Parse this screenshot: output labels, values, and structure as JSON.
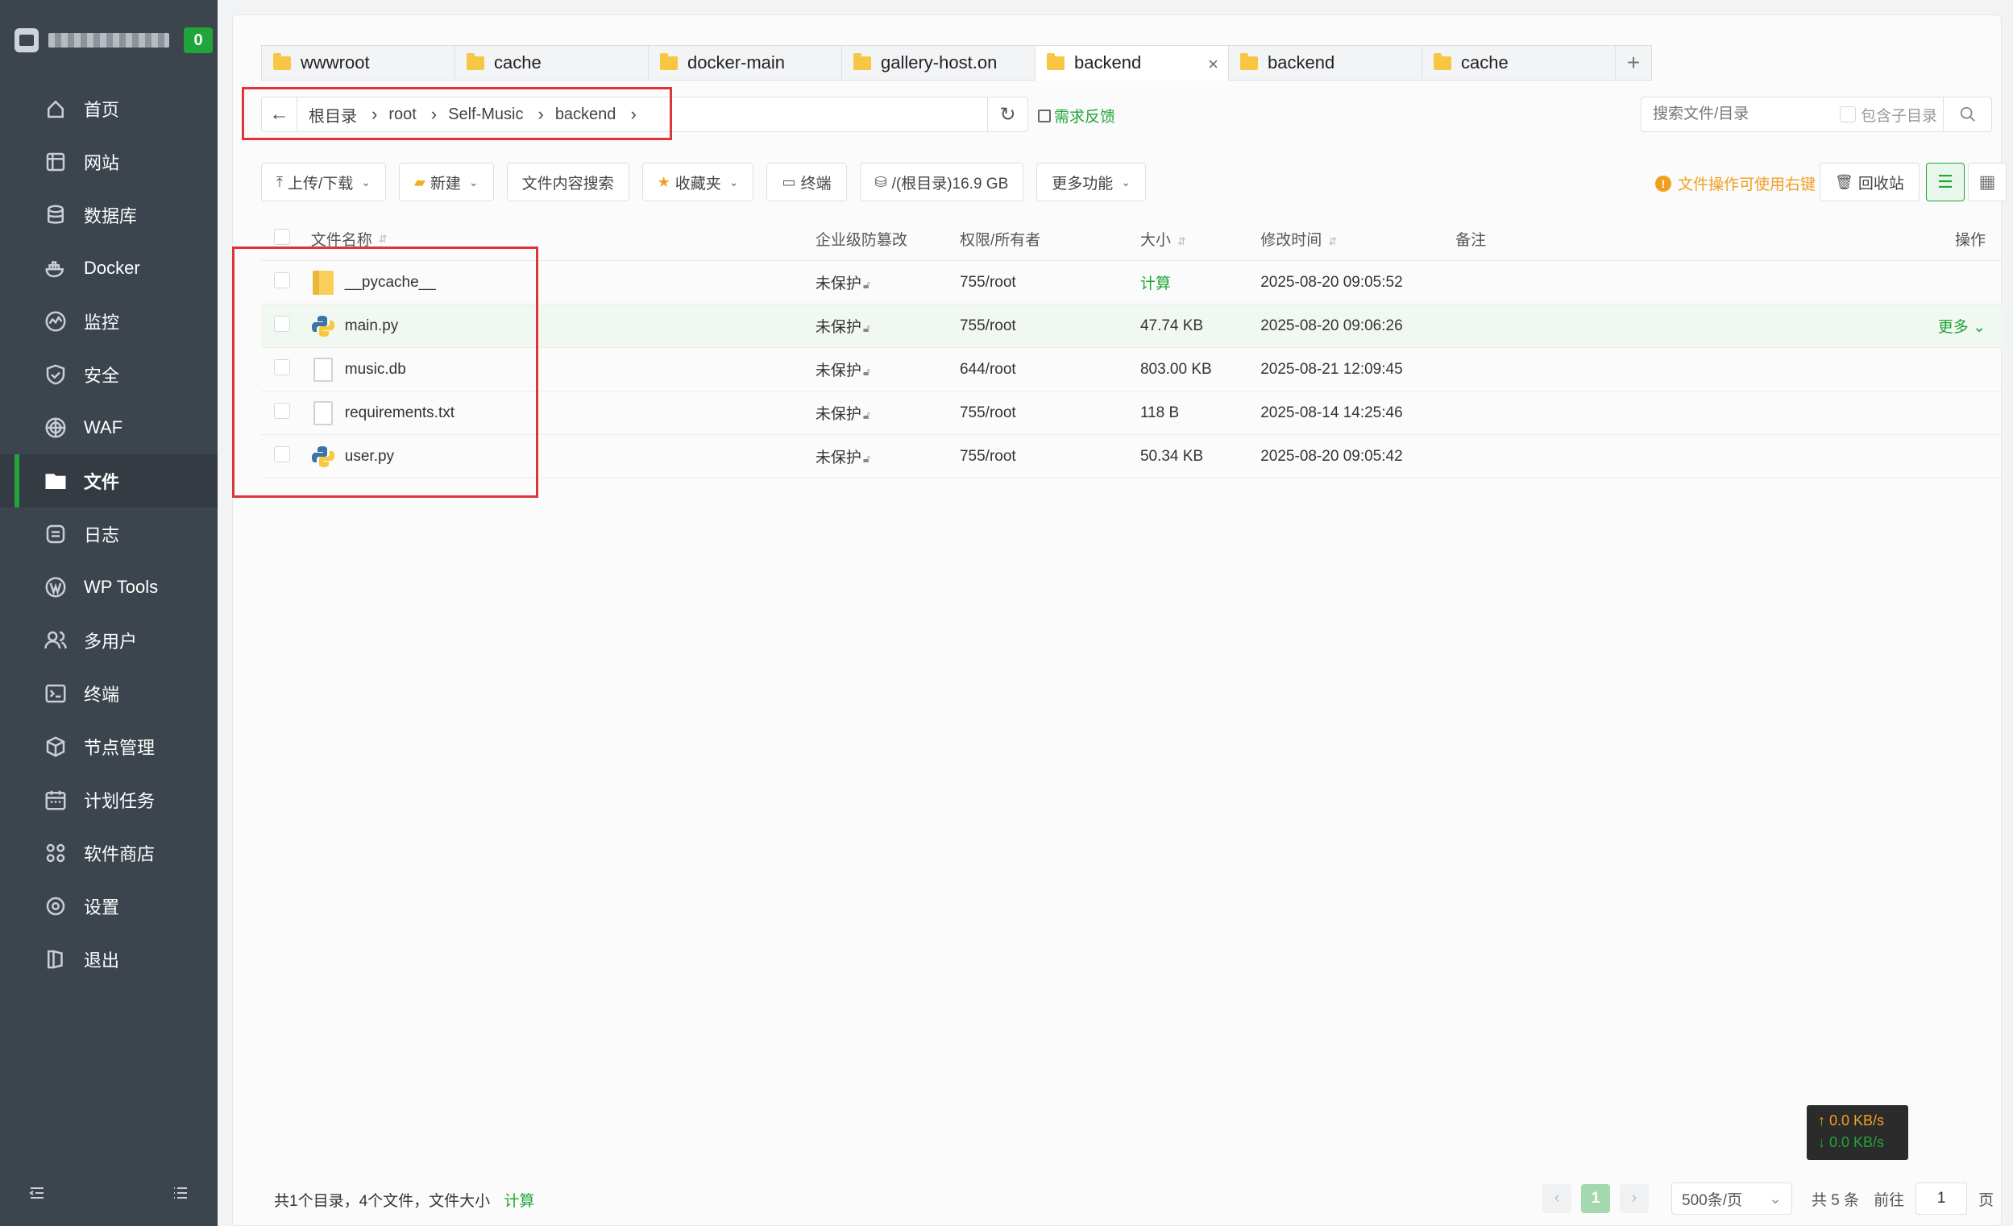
{
  "sidebar": {
    "badge": "0",
    "items": [
      {
        "label": "首页",
        "icon": "home-icon"
      },
      {
        "label": "网站",
        "icon": "globe-icon"
      },
      {
        "label": "数据库",
        "icon": "database-icon"
      },
      {
        "label": "Docker",
        "icon": "docker-icon"
      },
      {
        "label": "监控",
        "icon": "monitor-icon"
      },
      {
        "label": "安全",
        "icon": "shield-icon"
      },
      {
        "label": "WAF",
        "icon": "waf-icon"
      },
      {
        "label": "文件",
        "icon": "folder-icon"
      },
      {
        "label": "日志",
        "icon": "log-icon"
      },
      {
        "label": "WP Tools",
        "icon": "wordpress-icon"
      },
      {
        "label": "多用户",
        "icon": "users-icon"
      },
      {
        "label": "终端",
        "icon": "terminal-icon"
      },
      {
        "label": "节点管理",
        "icon": "cube-icon"
      },
      {
        "label": "计划任务",
        "icon": "calendar-icon"
      },
      {
        "label": "软件商店",
        "icon": "apps-icon"
      },
      {
        "label": "设置",
        "icon": "gear-icon"
      },
      {
        "label": "退出",
        "icon": "logout-icon"
      }
    ],
    "active_index": 7
  },
  "tabs": [
    {
      "label": "wwwroot"
    },
    {
      "label": "cache"
    },
    {
      "label": "docker-main"
    },
    {
      "label": "gallery-host.on"
    },
    {
      "label": "backend",
      "active": true
    },
    {
      "label": "backend"
    },
    {
      "label": "cache"
    }
  ],
  "tab_add": "+",
  "breadcrumb": [
    "根目录",
    "root",
    "Self-Music",
    "backend"
  ],
  "feedback_label": "需求反馈",
  "search": {
    "placeholder": "搜索文件/目录",
    "subdir_label": "包含子目录"
  },
  "toolbar": {
    "upload_download": "上传/下载",
    "new": "新建",
    "content_search": "文件内容搜索",
    "favorites": "收藏夹",
    "terminal": "终端",
    "disk": "/(根目录)16.9 GB",
    "more": "更多功能"
  },
  "tip": "文件操作可使用右键",
  "recycle_label": "回收站",
  "columns": {
    "name": "文件名称",
    "protection": "企业级防篡改",
    "perm": "权限/所有者",
    "size": "大小",
    "time": "修改时间",
    "note": "备注",
    "ops": "操作"
  },
  "files": [
    {
      "name": "__pycache__",
      "type": "folder",
      "protection": "未保护",
      "perm": "755/root",
      "size": "计算",
      "time": "2025-08-20 09:05:52",
      "ops": ""
    },
    {
      "name": "main.py",
      "type": "python",
      "protection": "未保护",
      "perm": "755/root",
      "size": "47.74 KB",
      "time": "2025-08-20 09:06:26",
      "ops": "更多 ⌄"
    },
    {
      "name": "music.db",
      "type": "file",
      "protection": "未保护",
      "perm": "644/root",
      "size": "803.00 KB",
      "time": "2025-08-21 12:09:45",
      "ops": ""
    },
    {
      "name": "requirements.txt",
      "type": "file",
      "protection": "未保护",
      "perm": "755/root",
      "size": "118 B",
      "time": "2025-08-14 14:25:46",
      "ops": ""
    },
    {
      "name": "user.py",
      "type": "python",
      "protection": "未保护",
      "perm": "755/root",
      "size": "50.34 KB",
      "time": "2025-08-20 09:05:42",
      "ops": ""
    }
  ],
  "footer": {
    "summary": "共1个目录，4个文件，文件大小",
    "calc": "计算",
    "current_page": "1",
    "page_size": "500条/页",
    "total": "共 5 条",
    "goto": "前往",
    "goto_value": "1",
    "page_unit": "页"
  },
  "speed": {
    "up": "↑ 0.0 KB/s",
    "down": "↓ 0.0 KB/s"
  },
  "colors": {
    "accent": "#20a53a",
    "sidebar": "#3c444d",
    "highlight_box": "#e0343c",
    "warning": "#f0a020"
  }
}
